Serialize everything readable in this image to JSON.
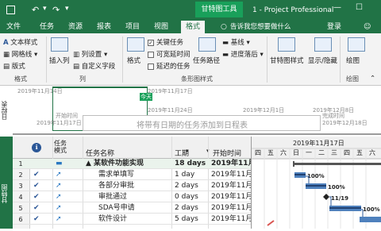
{
  "title_bar": {
    "context_tab": "甘特图工具",
    "doc_title": "1 - Project Professional",
    "login": "登录"
  },
  "tabs": [
    "文件",
    "任务",
    "资源",
    "报表",
    "项目",
    "视图",
    "格式"
  ],
  "active_tab": "格式",
  "tell_me": "告诉我您想要做什么",
  "ribbon": {
    "text_styles": "文本样式",
    "gridlines": "网格线",
    "layout": "版式",
    "group_format": "格式",
    "insert_column": "插入列",
    "column_settings": "列设置",
    "custom_fields": "自定义字段",
    "group_columns": "列",
    "format_btn": "格式",
    "critical_tasks": "关键任务",
    "slack": "可宽延时间",
    "late_tasks": "延迟的任务",
    "task_path": "任务路径",
    "baseline": "基线",
    "slippage": "进度落后",
    "group_bar_styles": "条形图样式",
    "gantt_styles": "甘特图样式",
    "show_hide": "显示/隐藏",
    "drawing": "绘图",
    "group_drawing": "绘图"
  },
  "timeline": {
    "side_label": "日程表",
    "today_label": "今天",
    "start_label": "开始时间",
    "start_date": "2019年11月17日",
    "end_label": "完成时间",
    "end_date": "2019年12月18日",
    "top_date_1": "2019年11月14日",
    "top_date_2": "2019年11月17日",
    "mid_date_1": "2019年11月24日",
    "mid_date_2": "2019年12月1日",
    "mid_date_3": "2019年12月8日",
    "hint": "将带有日期的任务添加到日程表"
  },
  "grid": {
    "side_label": "甘特图",
    "headers": {
      "info": "ℹ",
      "mode_1": "任务",
      "mode_2": "模式",
      "name": "任务名称",
      "duration": "工期",
      "start": "开始时间"
    },
    "rows": [
      {
        "id": "1",
        "name": "▲ 某软件功能实现",
        "duration": "18 days",
        "start": "2019年11月",
        "summary": true
      },
      {
        "id": "2",
        "name": "需求单填写",
        "duration": "1 day",
        "start": "2019年11月"
      },
      {
        "id": "3",
        "name": "各部分审批",
        "duration": "2 days",
        "start": "2019年11月"
      },
      {
        "id": "4",
        "name": "审批通过",
        "duration": "0 days",
        "start": "2019年11月"
      },
      {
        "id": "5",
        "name": "SDA号申请",
        "duration": "2 days",
        "start": "2019年11月"
      },
      {
        "id": "6",
        "name": "软件设计",
        "duration": "5 days",
        "start": "2019年11月"
      }
    ]
  },
  "gantt": {
    "week_date": "2019年11月17日",
    "days": [
      "四",
      "五",
      "六",
      "日",
      "一",
      "二",
      "三",
      "四",
      "五",
      "六"
    ],
    "labels": [
      "100%",
      "100%",
      "11/19",
      "100%"
    ]
  }
}
